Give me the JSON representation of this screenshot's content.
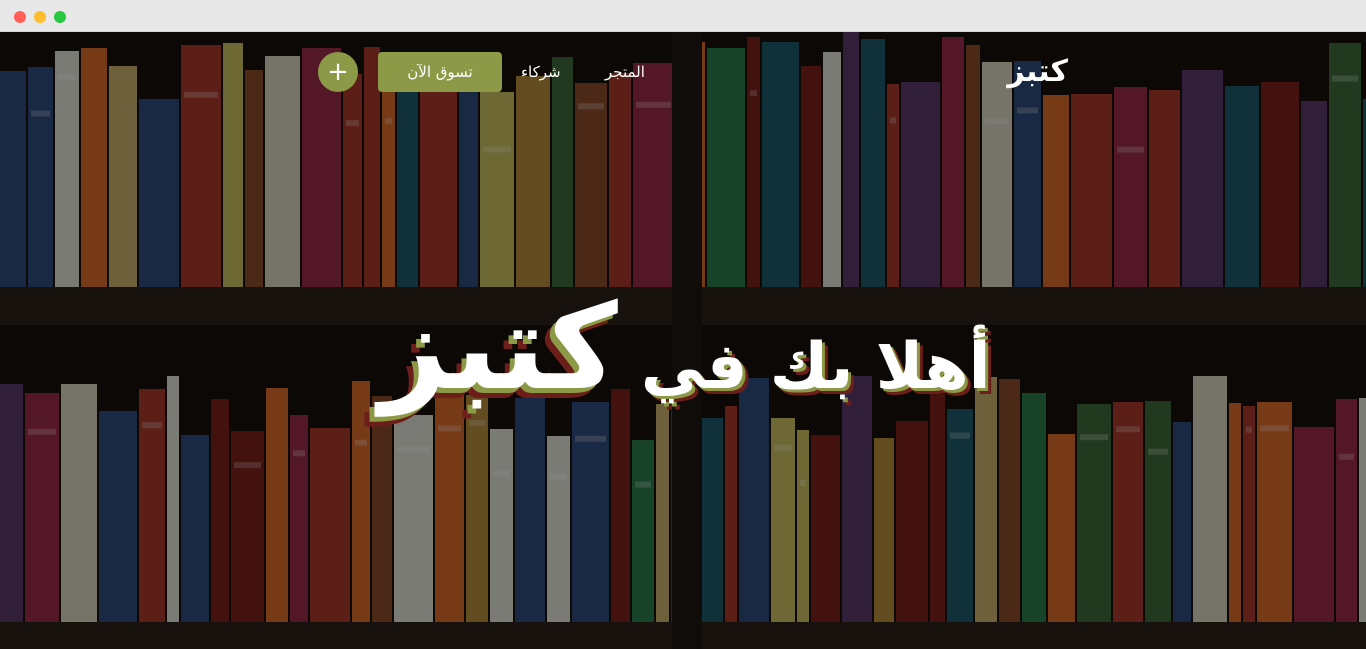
{
  "nav": {
    "logo": "كتبز",
    "links": [
      {
        "label": "المتجر"
      },
      {
        "label": "شركاء"
      }
    ],
    "shop_button": "تسوق الآن",
    "plus_button": "+"
  },
  "hero": {
    "welcome": "أهلا بك في",
    "brand": "كتبز"
  },
  "colors": {
    "accent": "#8c9a47",
    "shadow_dark": "#6b1e1a",
    "text": "#ffffff"
  }
}
